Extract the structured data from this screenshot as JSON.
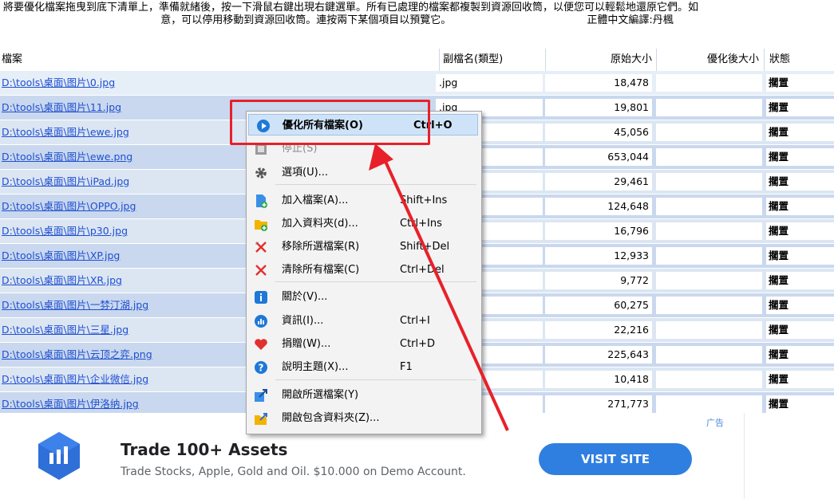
{
  "instructions": {
    "line1": "將要優化檔案拖曳到底下清單上，準備就緒後，按一下滑鼠右鍵出現右鍵選單。所有已處理的檔案都複製到資源回收筒，以便您可以輕鬆地還原它們。如",
    "line2": "意，可以停用移動到資源回收筒。連按兩下某個項目以預覽它。",
    "credit": "正體中文編譯:丹楓"
  },
  "table": {
    "headers": {
      "file": "檔案",
      "ext": "副檔名(類型)",
      "orig": "原始大小",
      "opt": "優化後大小",
      "status": "狀態"
    },
    "rows": [
      {
        "file": "D:\\tools\\桌面\\图片\\0.jpg",
        "ext": ".jpg",
        "orig": "18,478",
        "opt": "",
        "status": "擱置"
      },
      {
        "file": "D:\\tools\\桌面\\图片\\11.jpg",
        "ext": ".jpg",
        "orig": "19,801",
        "opt": "",
        "status": "擱置"
      },
      {
        "file": "D:\\tools\\桌面\\图片\\ewe.jpg",
        "ext": "",
        "orig": "45,056",
        "opt": "",
        "status": "擱置"
      },
      {
        "file": "D:\\tools\\桌面\\图片\\ewe.png",
        "ext": "",
        "orig": "653,044",
        "opt": "",
        "status": "擱置"
      },
      {
        "file": "D:\\tools\\桌面\\图片\\iPad.jpg",
        "ext": "",
        "orig": "29,461",
        "opt": "",
        "status": "擱置"
      },
      {
        "file": "D:\\tools\\桌面\\图片\\OPPO.jpg",
        "ext": "",
        "orig": "124,648",
        "opt": "",
        "status": "擱置"
      },
      {
        "file": "D:\\tools\\桌面\\图片\\p30.jpg",
        "ext": "",
        "orig": "16,796",
        "opt": "",
        "status": "擱置"
      },
      {
        "file": "D:\\tools\\桌面\\图片\\XP.jpg",
        "ext": "",
        "orig": "12,933",
        "opt": "",
        "status": "擱置"
      },
      {
        "file": "D:\\tools\\桌面\\图片\\XR.jpg",
        "ext": "",
        "orig": "9,772",
        "opt": "",
        "status": "擱置"
      },
      {
        "file": "D:\\tools\\桌面\\图片\\一棼汀湖.jpg",
        "ext": "",
        "orig": "60,275",
        "opt": "",
        "status": "擱置"
      },
      {
        "file": "D:\\tools\\桌面\\图片\\三星.jpg",
        "ext": "",
        "orig": "22,216",
        "opt": "",
        "status": "擱置"
      },
      {
        "file": "D:\\tools\\桌面\\图片\\云顶之弈.png",
        "ext": "",
        "orig": "225,643",
        "opt": "",
        "status": "擱置"
      },
      {
        "file": "D:\\tools\\桌面\\图片\\企业微信.jpg",
        "ext": "",
        "orig": "10,418",
        "opt": "",
        "status": "擱置"
      },
      {
        "file": "D:\\tools\\桌面\\图片\\伊洛纳.jpg",
        "ext": "",
        "orig": "271,773",
        "opt": "",
        "status": "擱置"
      }
    ]
  },
  "menu": {
    "items": [
      {
        "label": "優化所有檔案(O)",
        "shortcut": "Ctrl+O",
        "icon": "play-circle-icon",
        "highlight": true
      },
      {
        "label": "停止(S)",
        "shortcut": "",
        "icon": "stop-icon",
        "disabled": true
      },
      {
        "label": "選項(U)...",
        "shortcut": "",
        "icon": "gear-icon"
      },
      {
        "label": "加入檔案(A)...",
        "shortcut": "Shift+Ins",
        "icon": "add-file-icon"
      },
      {
        "label": "加入資料夾(d)...",
        "shortcut": "Ctrl+Ins",
        "icon": "add-folder-icon"
      },
      {
        "label": "移除所選檔案(R)",
        "shortcut": "Shift+Del",
        "icon": "remove-selected-icon"
      },
      {
        "label": "清除所有檔案(C)",
        "shortcut": "Ctrl+Del",
        "icon": "clear-all-icon"
      },
      {
        "label": "關於(V)...",
        "shortcut": "",
        "icon": "info-icon"
      },
      {
        "label": "資訊(I)...",
        "shortcut": "Ctrl+I",
        "icon": "stats-icon"
      },
      {
        "label": "捐贈(W)...",
        "shortcut": "Ctrl+D",
        "icon": "heart-icon"
      },
      {
        "label": "說明主題(X)...",
        "shortcut": "F1",
        "icon": "help-icon"
      },
      {
        "label": "開啟所選檔案(Y)",
        "shortcut": "",
        "icon": "open-file-icon"
      },
      {
        "label": "開啟包含資料夾(Z)...",
        "shortcut": "",
        "icon": "open-folder-icon"
      }
    ]
  },
  "ad": {
    "label": "广告",
    "title": "Trade 100+ Assets",
    "description": "Trade Stocks, Apple, Gold and Oil. $10.000 on Demo Account.",
    "button": "VISIT SITE"
  },
  "colors": {
    "accent_red": "#e8202a",
    "link_blue": "#1f4fd1",
    "ad_button": "#2f7fe0"
  }
}
